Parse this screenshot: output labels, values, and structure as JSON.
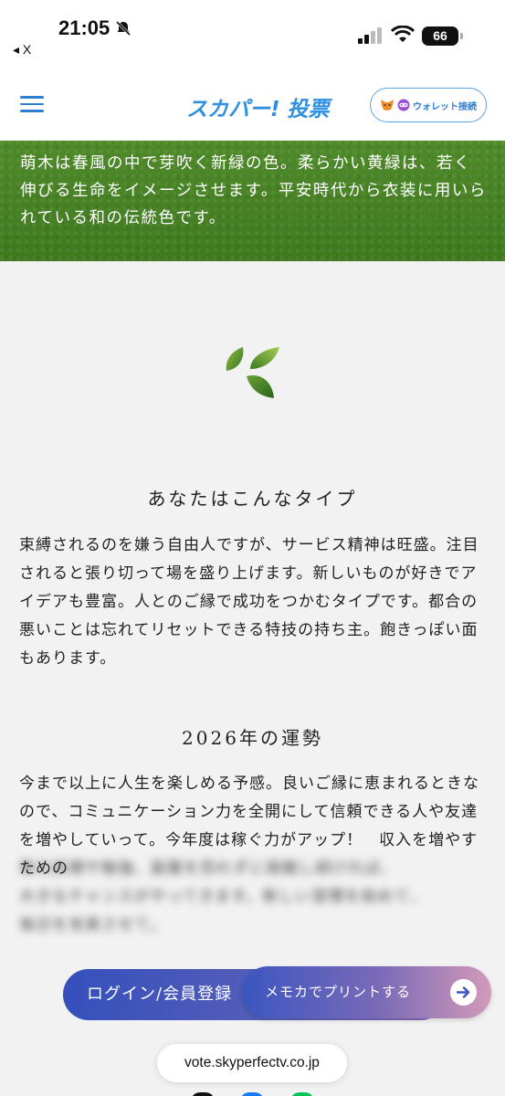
{
  "status_bar": {
    "time": "21:05",
    "back_label": "◂ X",
    "battery": "66"
  },
  "header": {
    "brand": "スカパー! 投票",
    "wallet_button": "ウォレット接続"
  },
  "banner": {
    "text": "萌木は春風の中で芽吹く新緑の色。柔らかい黄緑は、若く伸びる生命をイメージさせます。平安時代から衣装に用いられている和の伝統色です。"
  },
  "type_section": {
    "title": "あなたはこんなタイプ",
    "body": "束縛されるのを嫌う自由人ですが、サービス精神は旺盛。注目されると張り切って場を盛り上げます。新しいものが好きでアイデアも豊富。人とのご縁で成功をつかむタイプです。都合の悪いことは忘れてリセットできる特技の持ち主。飽きっぽい面もあります。"
  },
  "fortune_section": {
    "title": "2026年の運勢",
    "body": "今まで以上に人生を楽しめる予感。良いご縁に恵まれるときなので、コミュニケーション力を全開にして信頼できる人や友達を増やしていって。今年度は稼ぐ力がアップ！　収入を増やすための",
    "blurred_line1": "努力目標や勉強、副業を恐れずに挑戦し続ければ、",
    "blurred_line2": "大きなチャンスがやってきます。新しい習慣を始めて、",
    "blurred_line3": "毎日を充実させて。"
  },
  "buttons": {
    "login": "ログイン/会員登録",
    "print": "メモカでプリントする"
  },
  "browser": {
    "url": "vote.skyperfectv.co.jp"
  },
  "colors": {
    "brand_blue": "#2f8fe0",
    "banner_green": "#4a8426",
    "page_bg": "#f2f2f2"
  }
}
